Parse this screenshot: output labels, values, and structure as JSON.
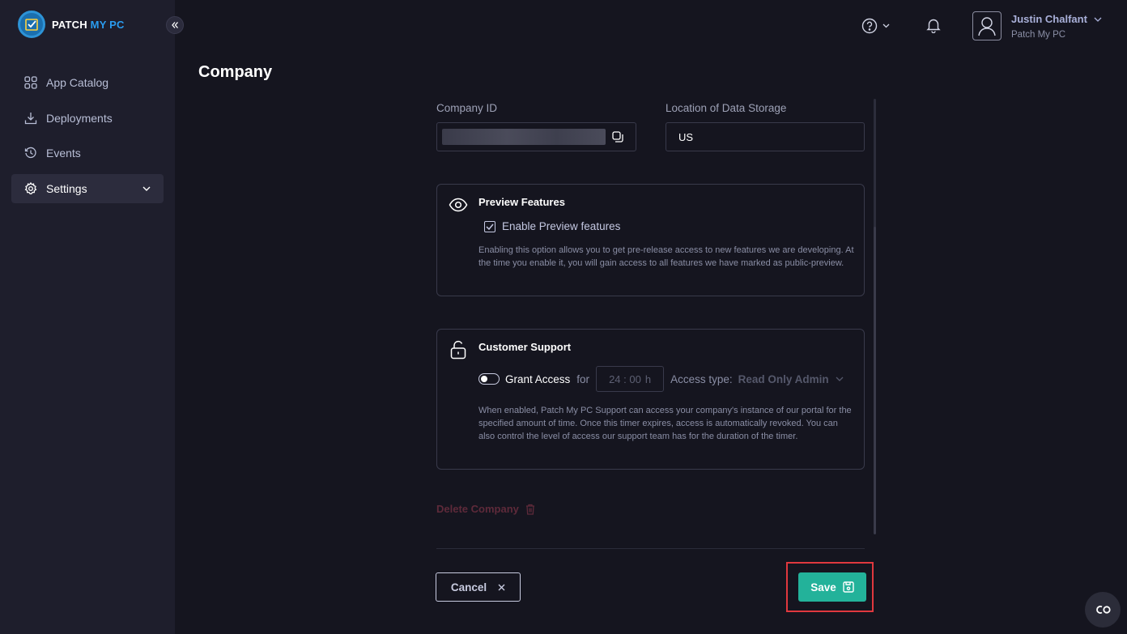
{
  "brand": {
    "name_part1": "PATCH",
    "name_part2": "MY PC"
  },
  "sidebar": {
    "items": [
      {
        "label": "App Catalog",
        "icon": "grid-icon"
      },
      {
        "label": "Deployments",
        "icon": "download-icon"
      },
      {
        "label": "Events",
        "icon": "history-icon"
      },
      {
        "label": "Settings",
        "icon": "gear-icon",
        "active": true
      }
    ]
  },
  "header": {
    "user_name": "Justin Chalfant",
    "user_org": "Patch My PC"
  },
  "page": {
    "title": "Company"
  },
  "company_id": {
    "label": "Company ID"
  },
  "data_storage": {
    "label": "Location of Data Storage",
    "value": "US"
  },
  "preview": {
    "title": "Preview Features",
    "checkbox_label": "Enable Preview features",
    "checked": true,
    "description": "Enabling this option allows you to get pre-release access to new features we are developing. At the time you enable it, you will gain access to all features we have marked as public-preview."
  },
  "support": {
    "title": "Customer Support",
    "grant_label": "Grant Access",
    "for_label": "for",
    "time_value": "24 : 00",
    "time_unit": "h",
    "access_type_label": "Access type:",
    "access_type_value": "Read Only Admin",
    "enabled": false,
    "description": "When enabled, Patch My PC Support can access your company's instance of our portal for the specified amount of time. Once this timer expires, access is automatically revoked. You can also control the level of access our support team has for the duration of the timer."
  },
  "delete": {
    "label": "Delete Company"
  },
  "actions": {
    "cancel_label": "Cancel",
    "save_label": "Save"
  },
  "colors": {
    "accent": "#23b29a",
    "highlight": "#e0383e",
    "danger": "#5e2a3a"
  }
}
